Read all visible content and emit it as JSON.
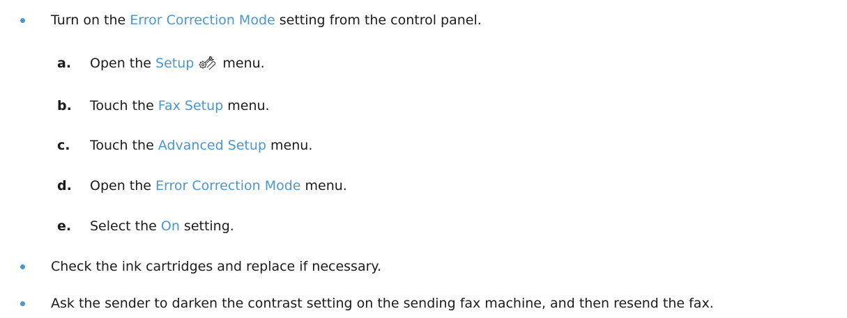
{
  "bullets": [
    {
      "before": "Turn on the ",
      "link": "Error Correction Mode",
      "after": " setting from the control panel."
    },
    {
      "text": "Check the ink cartridges and replace if necessary."
    },
    {
      "text": "Ask the sender to darken the contrast setting on the sending fax machine, and then resend the fax."
    }
  ],
  "steps": [
    {
      "letter": "a.",
      "before": "Open the ",
      "link": "Setup",
      "icon": "setup-wrench-gear-icon",
      "after": " menu."
    },
    {
      "letter": "b.",
      "before": "Touch the ",
      "link": "Fax Setup",
      "after": " menu."
    },
    {
      "letter": "c.",
      "before": "Touch the ",
      "link": "Advanced Setup",
      "after": " menu."
    },
    {
      "letter": "d.",
      "before": "Open the ",
      "link": "Error Correction Mode",
      "after": " menu."
    },
    {
      "letter": "e.",
      "before": "Select the ",
      "link": "On",
      "after": " setting."
    }
  ],
  "colors": {
    "link": "#4a96d2",
    "bullet": "#4a96d2",
    "text": "#1a1a1a"
  }
}
